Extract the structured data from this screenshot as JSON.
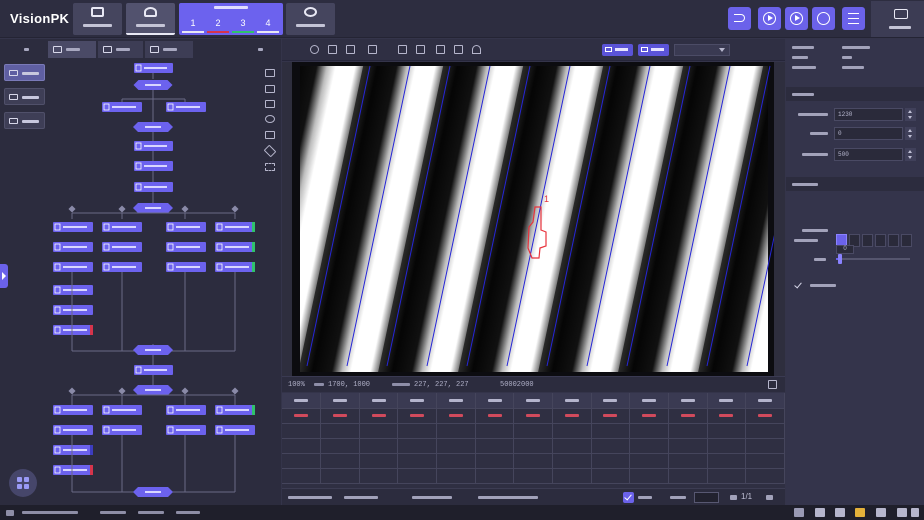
{
  "app": {
    "logo": "VisionPK",
    "steps": [
      "1",
      "2",
      "3",
      "4"
    ],
    "step_colors": [
      "#e8e8f4",
      "#d6344b",
      "#2fc36b",
      "#e8e8f4"
    ],
    "active_step_index": 3,
    "accent_color": "#6b62ea"
  },
  "controls": {
    "icons": [
      "undo-icon",
      "play-once-icon",
      "play-continuous-icon",
      "reset-icon",
      "menu-icon"
    ]
  },
  "image": {
    "stripe_count": 6,
    "defect_marker": "1"
  },
  "status_strip": {
    "items": [
      "100%",
      "1700, 1000",
      "227, 227, 227",
      "50002000"
    ]
  },
  "results": {
    "column_count": 13,
    "row_count": 5,
    "highlighted_row_index": 0,
    "highlight_color": "#d14a5c"
  },
  "pagination": {
    "label": "1/1"
  },
  "params": {
    "field_1": "1230",
    "field_2": "0",
    "field_3": "500",
    "segment_count": 6,
    "active_segment_index": 0,
    "level_value": "0",
    "slider_fraction": 0.05,
    "checkbox_checked": true
  }
}
